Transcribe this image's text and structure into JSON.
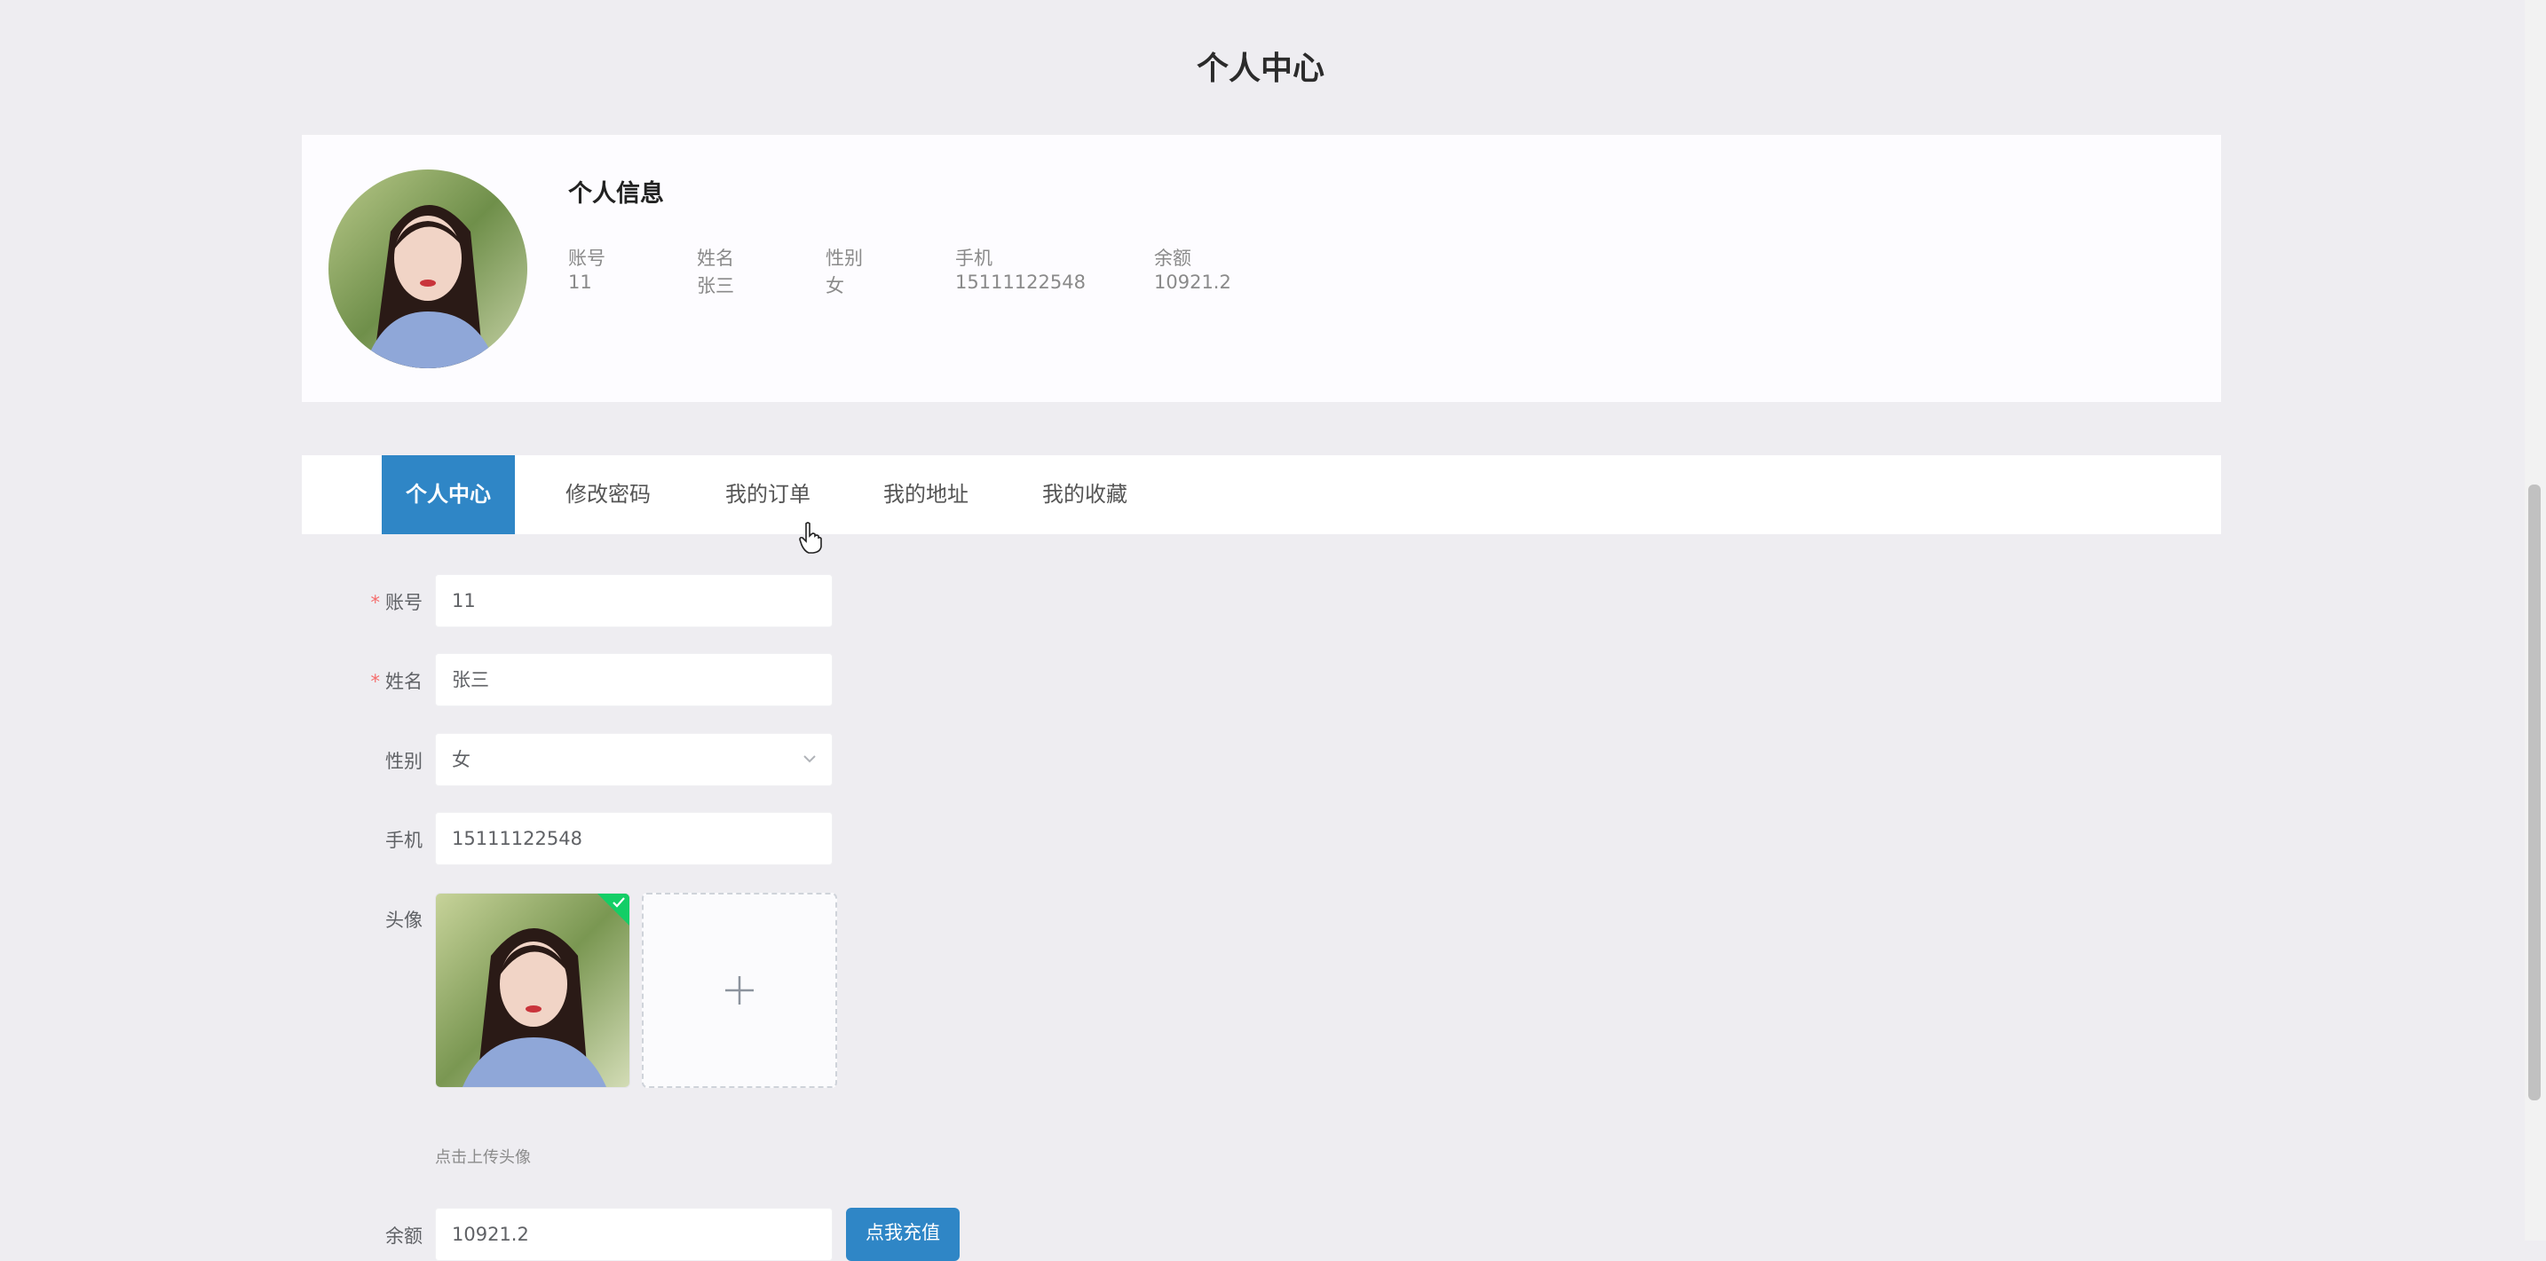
{
  "page": {
    "title": "个人中心"
  },
  "profile": {
    "heading": "个人信息",
    "fields": [
      {
        "label": "账号",
        "value": "11"
      },
      {
        "label": "姓名",
        "value": "张三"
      },
      {
        "label": "性别",
        "value": "女"
      },
      {
        "label": "手机",
        "value": "15111122548"
      },
      {
        "label": "余额",
        "value": "10921.2"
      }
    ]
  },
  "tabs": [
    {
      "label": "个人中心",
      "active": true
    },
    {
      "label": "修改密码",
      "active": false
    },
    {
      "label": "我的订单",
      "active": false
    },
    {
      "label": "我的地址",
      "active": false
    },
    {
      "label": "我的收藏",
      "active": false
    }
  ],
  "form": {
    "account": {
      "label": "账号",
      "required_mark": "*",
      "value": "11"
    },
    "name": {
      "label": "姓名",
      "required_mark": "*",
      "value": "张三"
    },
    "gender": {
      "label": "性别",
      "value": "女"
    },
    "phone": {
      "label": "手机",
      "value": "15111122548"
    },
    "avatar": {
      "label": "头像",
      "upload_hint": "点击上传头像"
    },
    "balance": {
      "label": "余额",
      "value": "10921.2",
      "recharge_label": "点我充值"
    }
  },
  "icons": {
    "dropdown": "chevron-down-icon",
    "upload": "plus-icon",
    "upload_success": "check-icon",
    "cursor": "hand-pointer-icon"
  },
  "colors": {
    "accent": "#2f86c6",
    "required": "#f56c6c",
    "success": "#13ce66"
  }
}
